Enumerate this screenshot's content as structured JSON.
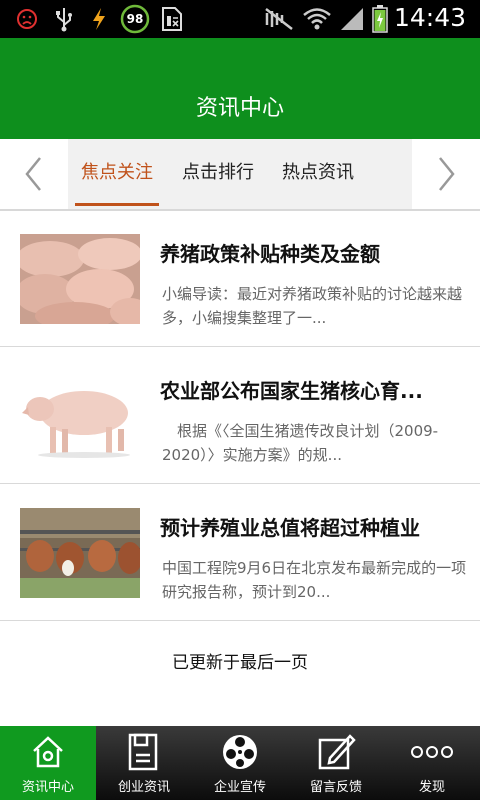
{
  "status_bar": {
    "time": "14:43",
    "battery_badge": "98",
    "icons": [
      "no-sim-warning-icon",
      "usb-icon",
      "charging-bolt-icon",
      "battery-level-badge",
      "calendar-app-icon",
      "mute-icon",
      "wifi-icon",
      "signal-icon",
      "battery-icon"
    ]
  },
  "header": {
    "title": "资讯中心"
  },
  "tabs": {
    "items": [
      "焦点关注",
      "点击排行",
      "热点资讯"
    ],
    "active_index": 0
  },
  "articles": [
    {
      "title": "养猪政策补贴种类及金额",
      "desc": "小编导读：最近对养猪政策补贴的讨论越来越多，小编搜集整理了一..."
    },
    {
      "title": "农业部公布国家生猪核心育...",
      "desc": "　根据《〈全国生猪遗传改良计划（2009-2020）〉实施方案》的规..."
    },
    {
      "title": "预计养殖业总值将超过种植业",
      "desc": "中国工程院9月6日在北京发布最新完成的一项研究报告称，预计到20..."
    }
  ],
  "load_more_text": "已更新于最后一页",
  "bottom_nav": [
    {
      "label": "资讯中心",
      "icon": "home-icon",
      "active": true
    },
    {
      "label": "创业资讯",
      "icon": "document-icon",
      "active": false
    },
    {
      "label": "企业宣传",
      "icon": "film-reel-icon",
      "active": false
    },
    {
      "label": "留言反馈",
      "icon": "edit-icon",
      "active": false
    },
    {
      "label": "发现",
      "icon": "more-dots-icon",
      "active": false
    }
  ],
  "colors": {
    "brand_green": "#0e8f1d",
    "active_tab": "#c0521b",
    "nav_active": "#109a1f"
  }
}
